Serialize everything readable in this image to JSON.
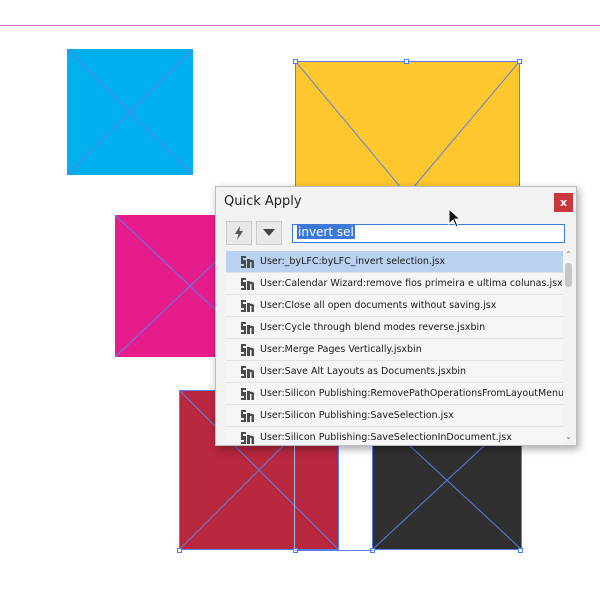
{
  "colors": {
    "cyan": "#00b0ee",
    "yellow": "#fec72e",
    "magenta": "#e71c8c",
    "crimson": "#b8283f",
    "dark": "#303030",
    "frame_line": "#5b7fe8",
    "selection": "#b9d2ef",
    "close": "#c8373b"
  },
  "dialog": {
    "title": "Quick Apply",
    "close_label": "x",
    "search": {
      "value": "invert sel"
    },
    "toolbar": {
      "bolt_icon": "bolt-icon",
      "dropdown_icon": "triangle-down-icon"
    },
    "items": [
      {
        "label": "User:_byLFC:byLFC_invert selection.jsx",
        "selected": true
      },
      {
        "label": "User:Calendar Wizard:remove fios  primeira e ultima colunas.jsx"
      },
      {
        "label": "User:Close all open documents without saving.jsx"
      },
      {
        "label": "User:Cycle through blend modes reverse.jsxbin"
      },
      {
        "label": "User:Merge Pages Vertically.jsxbin"
      },
      {
        "label": "User:Save Alt Layouts as Documents.jsxbin"
      },
      {
        "label": "User:Silicon Publishing:RemovePathOperationsFromLayoutMenu.jsx"
      },
      {
        "label": "User:Silicon Publishing:SaveSelection.jsx"
      },
      {
        "label": "User:Silicon Publishing:SaveSelectionInDocument.jsx"
      }
    ]
  }
}
